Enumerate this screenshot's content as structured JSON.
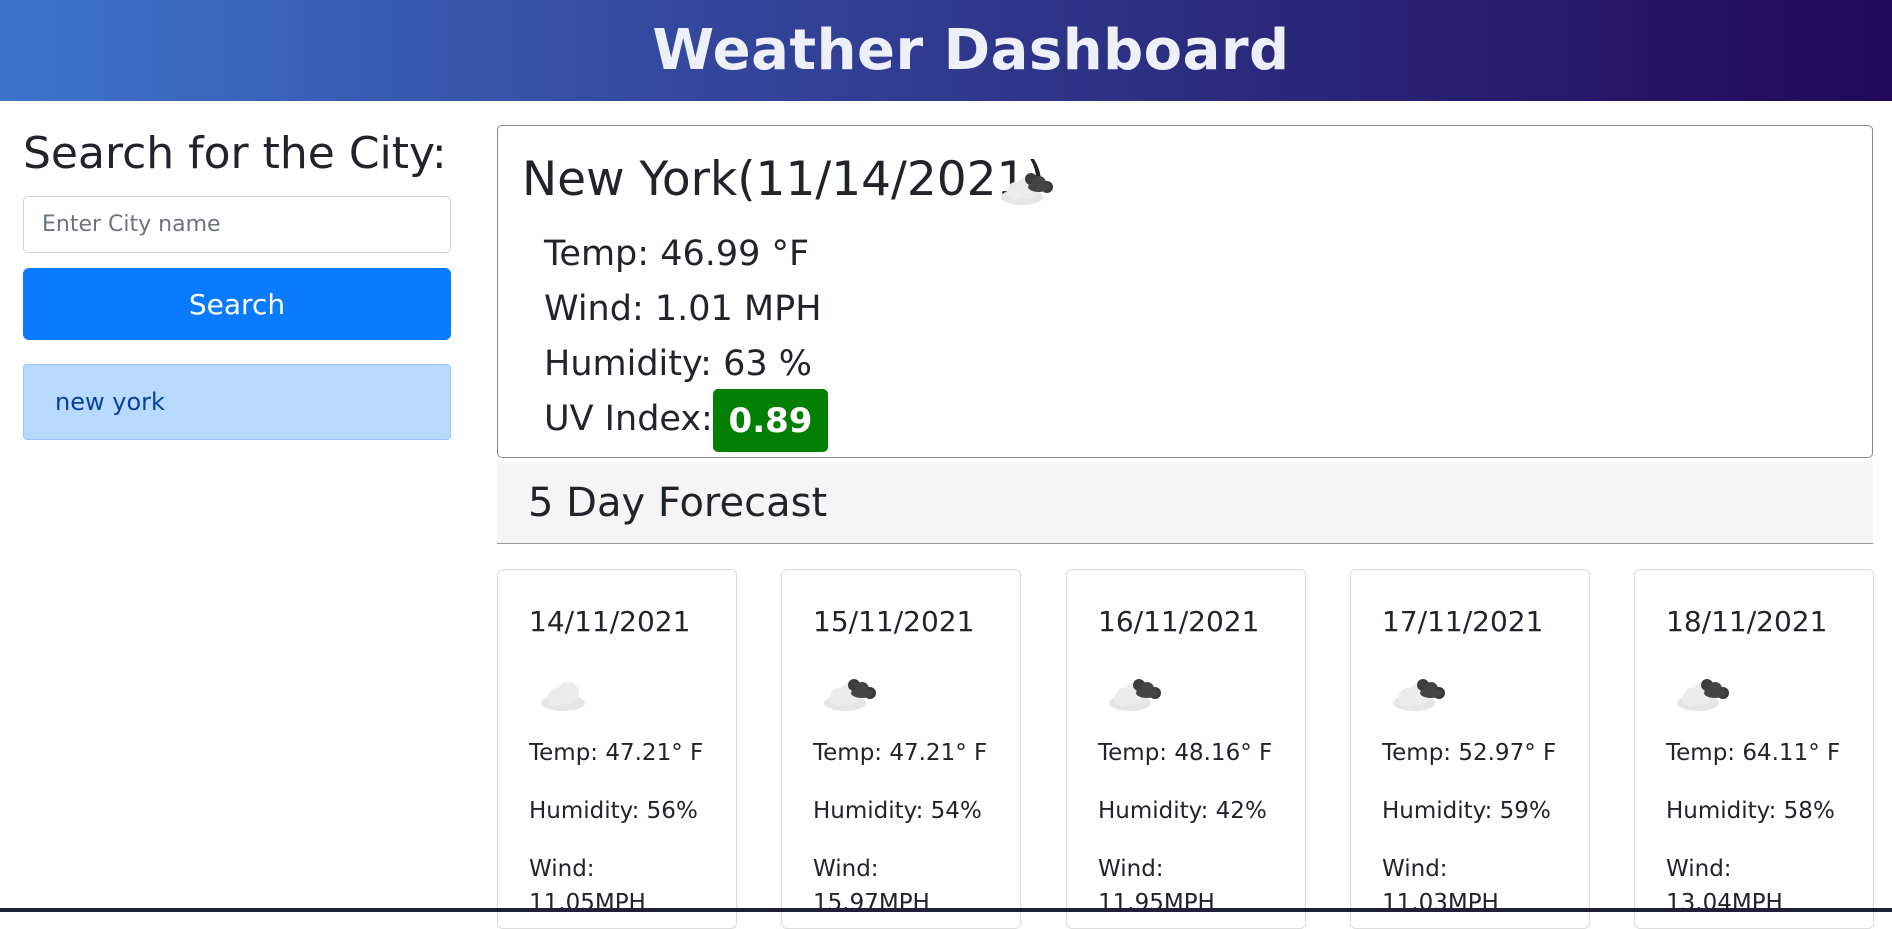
{
  "header": {
    "title": "Weather Dashboard"
  },
  "sidebar": {
    "heading": "Search for the City:",
    "input_placeholder": "Enter City name",
    "input_value": "",
    "search_label": "Search",
    "history": [
      "new york"
    ]
  },
  "current": {
    "title": "New York(11/14/2021)",
    "icon": "broken-clouds-icon",
    "temp": "Temp: 46.99 °F",
    "wind": "Wind: 1.01 MPH",
    "humidity": "Humidity: 63 %",
    "uv_label": "UV Index:",
    "uv_value": "0.89",
    "uv_color": "#038003"
  },
  "forecast": {
    "title": "5 Day Forecast",
    "days": [
      {
        "date": "14/11/2021",
        "icon": "few-clouds-icon",
        "temp": "Temp: 47.21° F",
        "humidity": "Humidity: 56%",
        "wind_label": "Wind:",
        "wind_value": "11.05MPH"
      },
      {
        "date": "15/11/2021",
        "icon": "broken-clouds-icon",
        "temp": "Temp: 47.21° F",
        "humidity": "Humidity: 54%",
        "wind_label": "Wind:",
        "wind_value": "15.97MPH"
      },
      {
        "date": "16/11/2021",
        "icon": "broken-clouds-icon",
        "temp": "Temp: 48.16° F",
        "humidity": "Humidity: 42%",
        "wind_label": "Wind:",
        "wind_value": "11.95MPH"
      },
      {
        "date": "17/11/2021",
        "icon": "broken-clouds-icon",
        "temp": "Temp: 52.97° F",
        "humidity": "Humidity: 59%",
        "wind_label": "Wind:",
        "wind_value": "11.03MPH"
      },
      {
        "date": "18/11/2021",
        "icon": "broken-clouds-icon",
        "temp": "Temp: 64.11° F",
        "humidity": "Humidity: 58%",
        "wind_label": "Wind:",
        "wind_value": "13.04MPH"
      }
    ]
  },
  "colors": {
    "accent": "#0a7bff",
    "history_bg": "#b8daff",
    "header_gradient_start": "#3c74cb",
    "header_gradient_end": "#22085a"
  }
}
